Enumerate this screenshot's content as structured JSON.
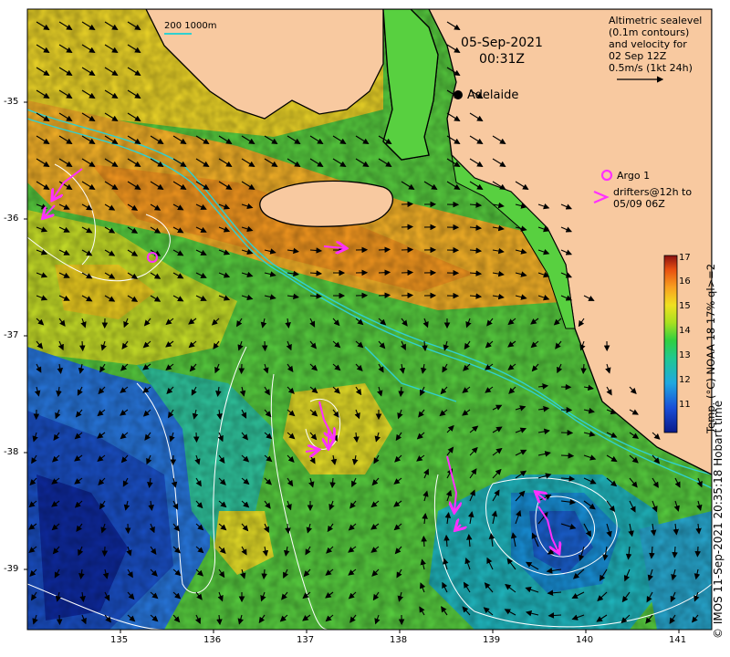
{
  "map": {
    "date": "05-Sep-2021",
    "time": "00:31Z",
    "altimetry_note": [
      "Altimetric sealevel",
      "(0.1m contours)",
      "and velocity for",
      "02 Sep 12Z",
      "0.5m/s (1kt 24h)"
    ],
    "city": "Adelaide",
    "argo_label": "Argo 1",
    "drifters_label": [
      "drifters@12h to",
      "05/09 06Z"
    ],
    "bathymetry_scale": "200  1000m",
    "credit": "© IMOS 11-Sep-2021 20:35:18 Hobart time",
    "longitude_ticks": [
      "135",
      "136",
      "137",
      "138",
      "139",
      "140",
      "141"
    ],
    "latitude_ticks": [
      "-35",
      "-36",
      "-37",
      "-38",
      "-39"
    ],
    "colorbar": {
      "title": "Temp. (°C) NOAA 18 17% ql>=2",
      "ticks": [
        "17",
        "16",
        "15",
        "14",
        "13",
        "12",
        "11"
      ]
    },
    "colors": {
      "land": "#f8c9a0",
      "coast": "#000000",
      "contours": "#ffffff",
      "bathymetry_200": "#30d0d0",
      "drifters": "#ff30ff",
      "arrows": "#000000"
    }
  }
}
